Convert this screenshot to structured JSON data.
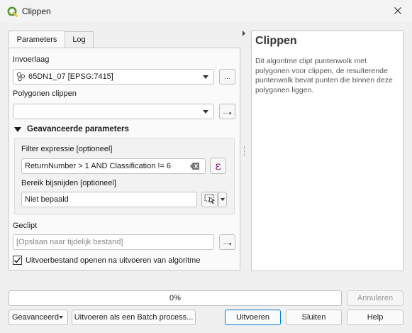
{
  "window": {
    "title": "Clippen",
    "close_icon": "close-icon",
    "app_icon": "qgis-icon"
  },
  "tabs": [
    {
      "label": "Parameters",
      "active": true
    },
    {
      "label": "Log",
      "active": false
    }
  ],
  "params": {
    "input_layer": {
      "label": "Invoerlaag",
      "value": "65DN1_07 [EPSG:7415]",
      "browse": "..."
    },
    "clip_polygons": {
      "label": "Polygonen clippen",
      "value": "",
      "browse": "..."
    },
    "advanced": {
      "label": "Geavanceerde parameters",
      "filter_label": "Filter expressie [optioneel]",
      "filter_value": "ReturnNumber > 1 AND Classification != 6",
      "expr_button": "ε",
      "extent_label": "Bereik bijsnijden [optioneel]",
      "extent_value": "Niet bepaald"
    },
    "output": {
      "label": "Geclipt",
      "placeholder": "[Opslaan naar tijdelijk bestand]",
      "browse": "..."
    },
    "open_output": {
      "label": "Uitvoerbestand openen na uitvoeren van algoritme",
      "checked": true
    }
  },
  "help": {
    "title": "Clippen",
    "text": "Dit algoritme clipt puntenwolk met polygonen voor clippen, de resulterende puntenwolk bevat punten die binnen deze polygonen liggen."
  },
  "progress": {
    "text": "0%",
    "value": 0
  },
  "buttons": {
    "cancel": "Annuleren",
    "advanced": "Geavanceerd",
    "batch": "Uitvoeren als een Batch process...",
    "run": "Uitvoeren",
    "close": "Sluiten",
    "help": "Help"
  },
  "colors": {
    "accent": "#0078d4",
    "qgis_green": "#589632",
    "qgis_yellow": "#f0c020"
  }
}
